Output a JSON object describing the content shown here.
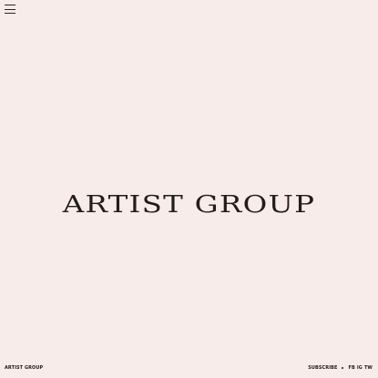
{
  "header": {
    "menu_icon": "hamburger-menu-icon"
  },
  "hero": {
    "title": "ARTIST GROUP"
  },
  "footer": {
    "brand": "ARTIST GROUP",
    "subscribe_label": "SUBSCRIBE",
    "social": [
      "FB",
      "IG",
      "TW"
    ]
  },
  "colors": {
    "background": "#f8ecea",
    "text": "#1e1a18"
  }
}
